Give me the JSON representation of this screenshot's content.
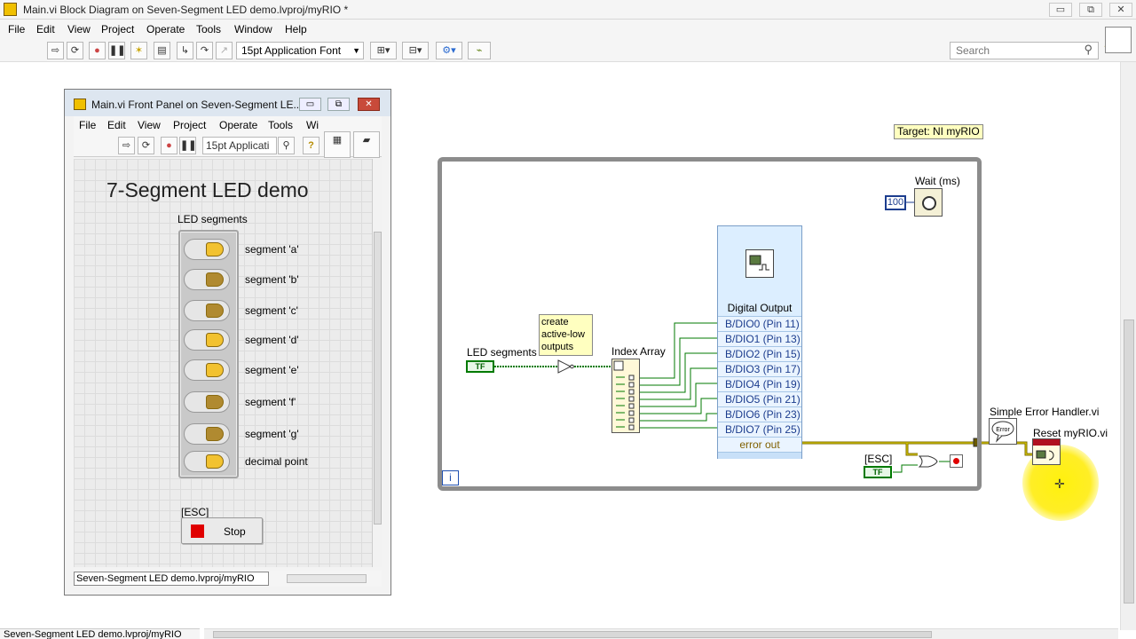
{
  "window": {
    "title": "Main.vi Block Diagram on Seven-Segment LED demo.lvproj/myRIO *",
    "controls": {
      "minimize": "▭",
      "restore": "⧉",
      "close": "✕"
    }
  },
  "menu": [
    "File",
    "Edit",
    "View",
    "Project",
    "Operate",
    "Tools",
    "Window",
    "Help"
  ],
  "toolbar": {
    "font": "15pt Application Font",
    "search_placeholder": "Search",
    "help": "?"
  },
  "front_panel": {
    "title": "Main.vi Front Panel on Seven-Segment LE...",
    "menu": [
      "File",
      "Edit",
      "View",
      "Project",
      "Operate",
      "Tools",
      "Wi"
    ],
    "font": "15pt Applicati",
    "heading": "7-Segment LED demo",
    "cluster_label": "LED segments",
    "leds": [
      {
        "label": "segment 'a'",
        "color": "#f2c230"
      },
      {
        "label": "segment 'b'",
        "color": "#b08a30"
      },
      {
        "label": "segment 'c'",
        "color": "#b08a30"
      },
      {
        "label": "segment 'd'",
        "color": "#f2c230"
      },
      {
        "label": "segment 'e'",
        "color": "#f2c230"
      },
      {
        "label": "segment 'f'",
        "color": "#b08a30"
      },
      {
        "label": "segment 'g'",
        "color": "#b08a30"
      },
      {
        "label": "decimal point",
        "color": "#f2c230"
      }
    ],
    "esc_label": "[ESC]",
    "stop_label": "Stop",
    "status_path": "Seven-Segment LED demo.lvproj/myRIO"
  },
  "diagram": {
    "target": "Target: NI myRIO",
    "wait_label": "Wait (ms)",
    "wait_value": "100",
    "led_segments_label": "LED segments",
    "bool_text": "TF",
    "comment": [
      "create",
      "active-low",
      "outputs"
    ],
    "index_array_label": "Index Array",
    "digital_output": {
      "header": "Digital Output",
      "pins": [
        "B/DIO0 (Pin 11)",
        "B/DIO1 (Pin 13)",
        "B/DIO2 (Pin 15)",
        "B/DIO3 (Pin 17)",
        "B/DIO4 (Pin 19)",
        "B/DIO5 (Pin 21)",
        "B/DIO6 (Pin 23)",
        "B/DIO7 (Pin 25)"
      ],
      "error_out": "error out"
    },
    "esc_label": "[ESC]",
    "error_handler_label": "Simple Error Handler.vi",
    "reset_label": "Reset myRIO.vi",
    "loop_index": "i"
  },
  "status_path": "Seven-Segment LED demo.lvproj/myRIO"
}
